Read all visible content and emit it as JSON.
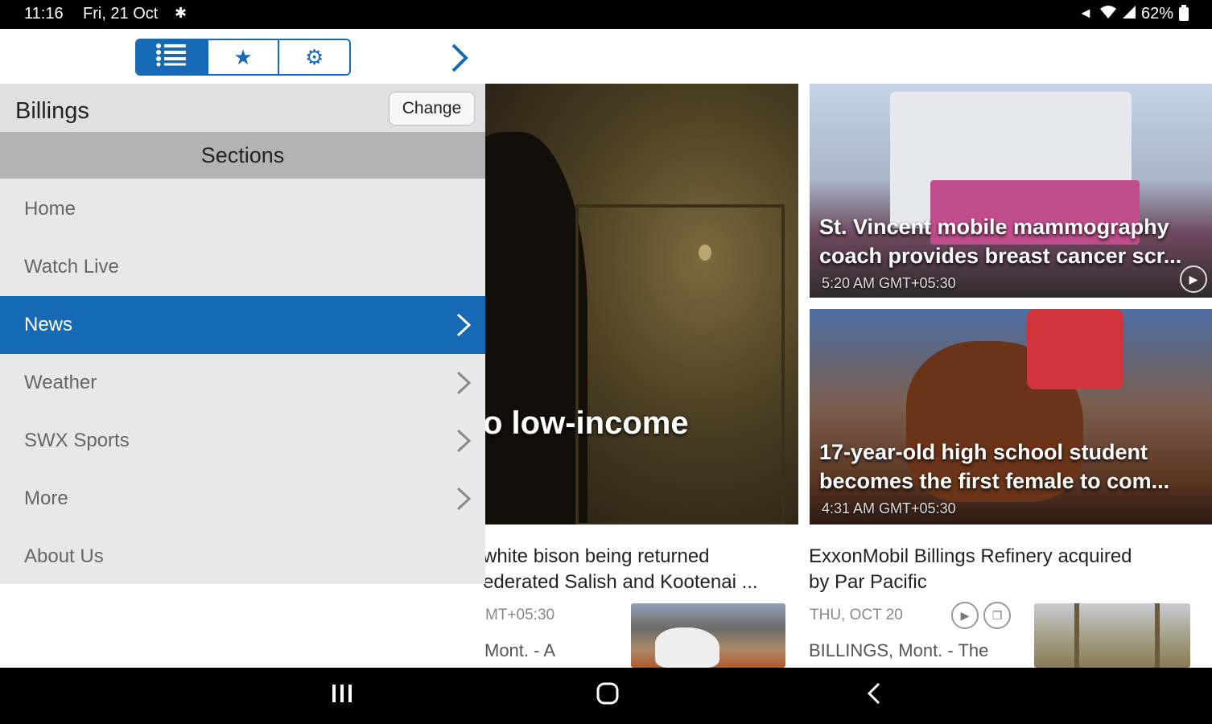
{
  "status_bar": {
    "time": "11:16",
    "date": "Fri, 21 Oct",
    "notif_icon": "fan-icon",
    "battery": "62%"
  },
  "toolbar": {
    "tabs": [
      {
        "icon": "list-icon",
        "active": true
      },
      {
        "icon": "star-icon",
        "active": false
      },
      {
        "icon": "gear-icon",
        "active": false
      }
    ]
  },
  "drawer": {
    "city": "Billings",
    "change_label": "Change",
    "sections_label": "Sections",
    "items": [
      {
        "label": "Home",
        "has_chevron": false,
        "active": false
      },
      {
        "label": "Watch Live",
        "has_chevron": false,
        "active": false
      },
      {
        "label": "News",
        "has_chevron": true,
        "active": true
      },
      {
        "label": "Weather",
        "has_chevron": true,
        "active": false
      },
      {
        "label": "SWX Sports",
        "has_chevron": true,
        "active": false
      },
      {
        "label": "More",
        "has_chevron": true,
        "active": false
      },
      {
        "label": "About Us",
        "has_chevron": false,
        "active": false
      }
    ]
  },
  "content": {
    "hero": {
      "headline_visible": "o low-income"
    },
    "cards": [
      {
        "title": "St. Vincent mobile mammography coach provides breast cancer scr...",
        "time": "5:20 AM GMT+05:30"
      },
      {
        "title": "17-year-old high school student becomes the first female to com...",
        "time": "4:31 AM GMT+05:30"
      }
    ],
    "lower_left": {
      "title_line1": "white bison being returned",
      "title_line2": "ederated Salish and Kootenai ...",
      "meta": "MT+05:30",
      "body": "Mont. - A"
    },
    "lower_right": {
      "title_line1": "ExxonMobil Billings Refinery acquired",
      "title_line2": "by Par Pacific",
      "meta": "THU, OCT 20",
      "body": "BILLINGS, Mont. - The"
    }
  },
  "colors": {
    "accent": "#1569b5",
    "drawer_bg": "#e8e8e8",
    "sections_bg": "#b3b3b3"
  }
}
